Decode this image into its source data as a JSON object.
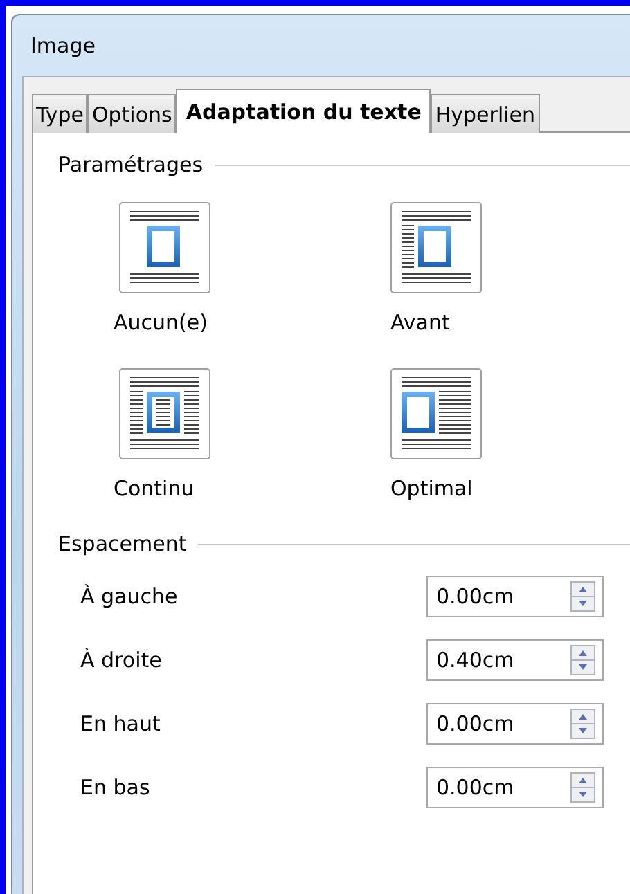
{
  "window": {
    "title": "Image"
  },
  "tabs": [
    {
      "label": "Type",
      "selected": false
    },
    {
      "label": "Options",
      "selected": false
    },
    {
      "label": "Adaptation du texte",
      "selected": true
    },
    {
      "label": "Hyperlien",
      "selected": false
    }
  ],
  "settings": {
    "title": "Paramétrages",
    "options": [
      {
        "kind": "none",
        "label": "Aucun(e)"
      },
      {
        "kind": "before",
        "label": "Avant"
      },
      {
        "kind": "through",
        "label": "Continu"
      },
      {
        "kind": "optimal",
        "label": "Optimal"
      }
    ]
  },
  "spacing": {
    "title": "Espacement",
    "fields": [
      {
        "label": "À gauche",
        "value": "0.00cm"
      },
      {
        "label": "À droite",
        "value": "0.40cm"
      },
      {
        "label": "En haut",
        "value": "0.00cm"
      },
      {
        "label": "En bas",
        "value": "0.00cm"
      }
    ]
  }
}
